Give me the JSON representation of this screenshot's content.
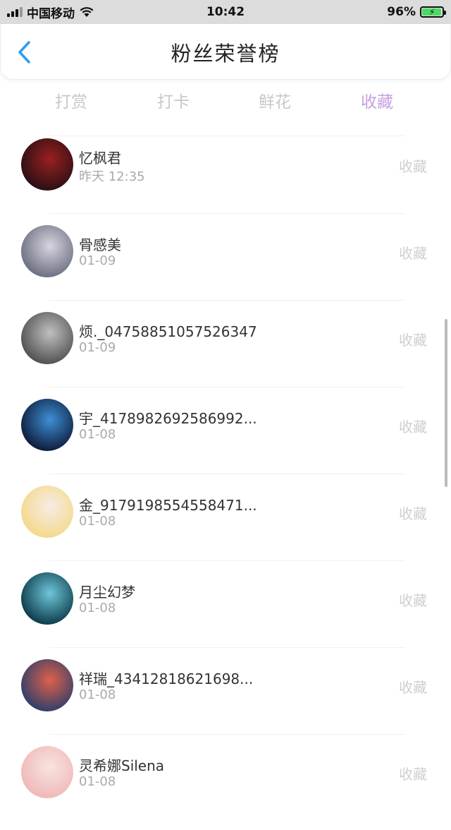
{
  "status_bar": {
    "carrier": "中国移动",
    "time": "10:42",
    "battery": "96%"
  },
  "header": {
    "title": "粉丝荣誉榜",
    "back_icon": "chevron-left-icon"
  },
  "tabs": [
    {
      "label": "打赏",
      "active": false
    },
    {
      "label": "打卡",
      "active": false
    },
    {
      "label": "鲜花",
      "active": false
    },
    {
      "label": "收藏",
      "active": true
    }
  ],
  "list": [
    {
      "name": "忆枫君",
      "date": "昨天 12:35",
      "action": "收藏",
      "avatar_colors": [
        "#2a0f14",
        "#9a2020"
      ]
    },
    {
      "name": "骨感美",
      "date": "01-09",
      "action": "收藏",
      "avatar_colors": [
        "#6a6f80",
        "#d9d4e0"
      ]
    },
    {
      "name": "烦._04758851057526347",
      "date": "01-09",
      "action": "收藏",
      "avatar_colors": [
        "#505050",
        "#c0c0c0"
      ]
    },
    {
      "name": "宇_4178982692586992...",
      "date": "01-08",
      "action": "收藏",
      "avatar_colors": [
        "#0e1c3a",
        "#3d8fd6"
      ]
    },
    {
      "name": "金_9179198554558471...",
      "date": "01-08",
      "action": "收藏",
      "avatar_colors": [
        "#f4d98a",
        "#f6ece6"
      ]
    },
    {
      "name": "月尘幻梦",
      "date": "01-08",
      "action": "收藏",
      "avatar_colors": [
        "#0c3a4a",
        "#6fc6d8"
      ]
    },
    {
      "name": "祥瑞_43412818621698...",
      "date": "01-08",
      "action": "收藏",
      "avatar_colors": [
        "#2f3f6a",
        "#e0604a"
      ]
    },
    {
      "name": "灵希娜Silena",
      "date": "01-08",
      "action": "收藏",
      "avatar_colors": [
        "#f0b8b8",
        "#f7e4e0"
      ]
    }
  ]
}
